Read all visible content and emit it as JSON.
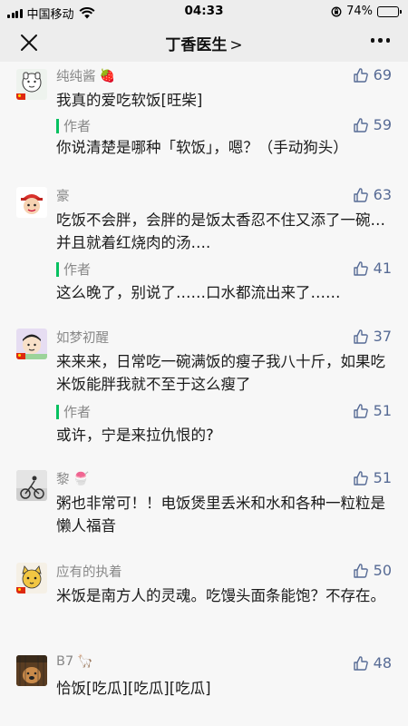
{
  "status_bar": {
    "carrier": "中国移动",
    "time": "04:33",
    "battery": "74%",
    "battery_level": 0.74
  },
  "nav": {
    "title": "丁香医生",
    "title_chevron": ">"
  },
  "comments": [
    {
      "nick": "纯纯酱",
      "badge_icon": "strawberry-icon",
      "likes": "69",
      "text": "我真的爱吃软饭[旺柴]",
      "reply": {
        "label": "作者",
        "likes": "59",
        "text": "你说清楚是哪种「软饭」，嗯？（手动狗头）"
      }
    },
    {
      "nick": "豪",
      "likes": "63",
      "text": "吃饭不会胖，会胖的是饭太香忍不住又添了一碗…并且就着红烧肉的汤….",
      "reply": {
        "label": "作者",
        "likes": "41",
        "text": "这么晚了，别说了……口水都流出来了……"
      }
    },
    {
      "nick": "如梦初醒",
      "likes": "37",
      "text": "来来来，日常吃一碗满饭的瘦子我八十斤，如果吃米饭能胖我就不至于这么瘦了",
      "reply": {
        "label": "作者",
        "likes": "51",
        "text": "或许，宁是来拉仇恨的?"
      }
    },
    {
      "nick": "黎",
      "badge_icon": "shaved-ice-icon",
      "likes": "51",
      "text": "粥也非常可！！电饭煲里丢米和水和各种一粒粒是懒人福音"
    },
    {
      "nick": "应有的执着",
      "likes": "50",
      "text": "米饭是南方人的灵魂。吃馒头面条能饱？不存在。"
    },
    {
      "nick": "B7",
      "badge_icon": "llama-icon",
      "likes": "48",
      "text": "恰饭[吃瓜][吃瓜][吃瓜]"
    }
  ]
}
